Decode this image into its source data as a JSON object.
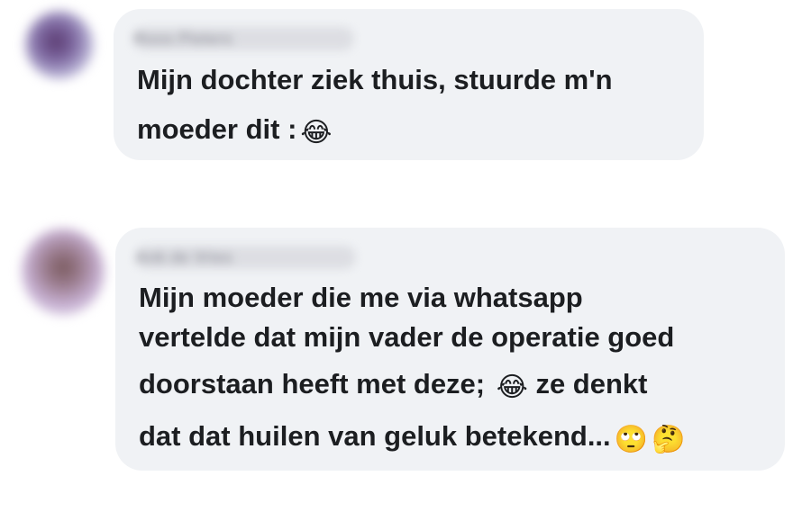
{
  "comments": [
    {
      "author": "Roos Pieters",
      "lines": [
        "Mijn dochter ziek thuis, stuurde m'n",
        "moeder dit :"
      ],
      "emoji": "😂"
    },
    {
      "author": "Ank de Vries",
      "lines": [
        "Mijn moeder die me via whatsapp",
        "vertelde dat mijn vader de operatie goed",
        "doorstaan heeft met deze;",
        "ze denkt",
        "dat dat huilen van geluk betekend..."
      ],
      "emoji_inline": "😂",
      "emoji_end": [
        "🙄",
        "🤔"
      ]
    }
  ]
}
